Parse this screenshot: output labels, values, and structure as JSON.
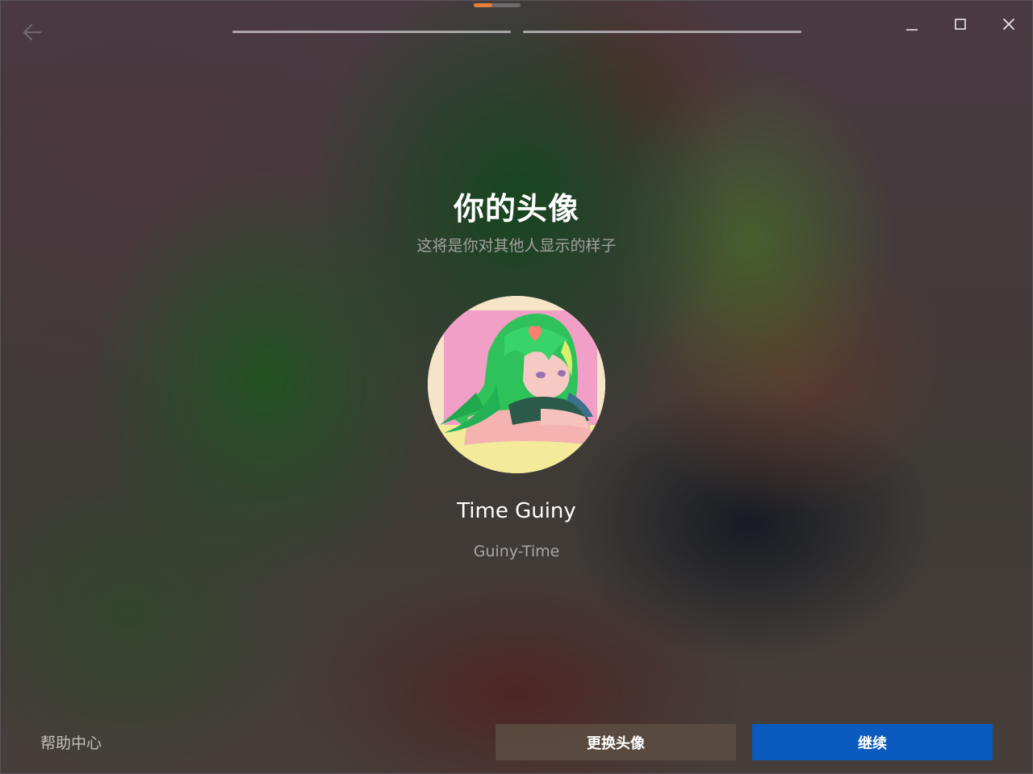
{
  "header": {
    "back_icon": "arrow-left-icon",
    "window_controls": [
      "minimize-icon",
      "maximize-icon",
      "close-icon"
    ],
    "top_indicator_progress": 0.4,
    "steps_total": 2,
    "accent_color": "#e0803a"
  },
  "main": {
    "title": "你的头像",
    "subtitle": "这将是你对其他人显示的样子",
    "avatar_alt_icon": "avatar-image",
    "display_name": "Time Guiny",
    "username": "Guiny-Time"
  },
  "footer": {
    "help_label": "帮助中心",
    "change_avatar_label": "更换头像",
    "continue_label": "继续",
    "primary_color": "#0a5bbd"
  }
}
